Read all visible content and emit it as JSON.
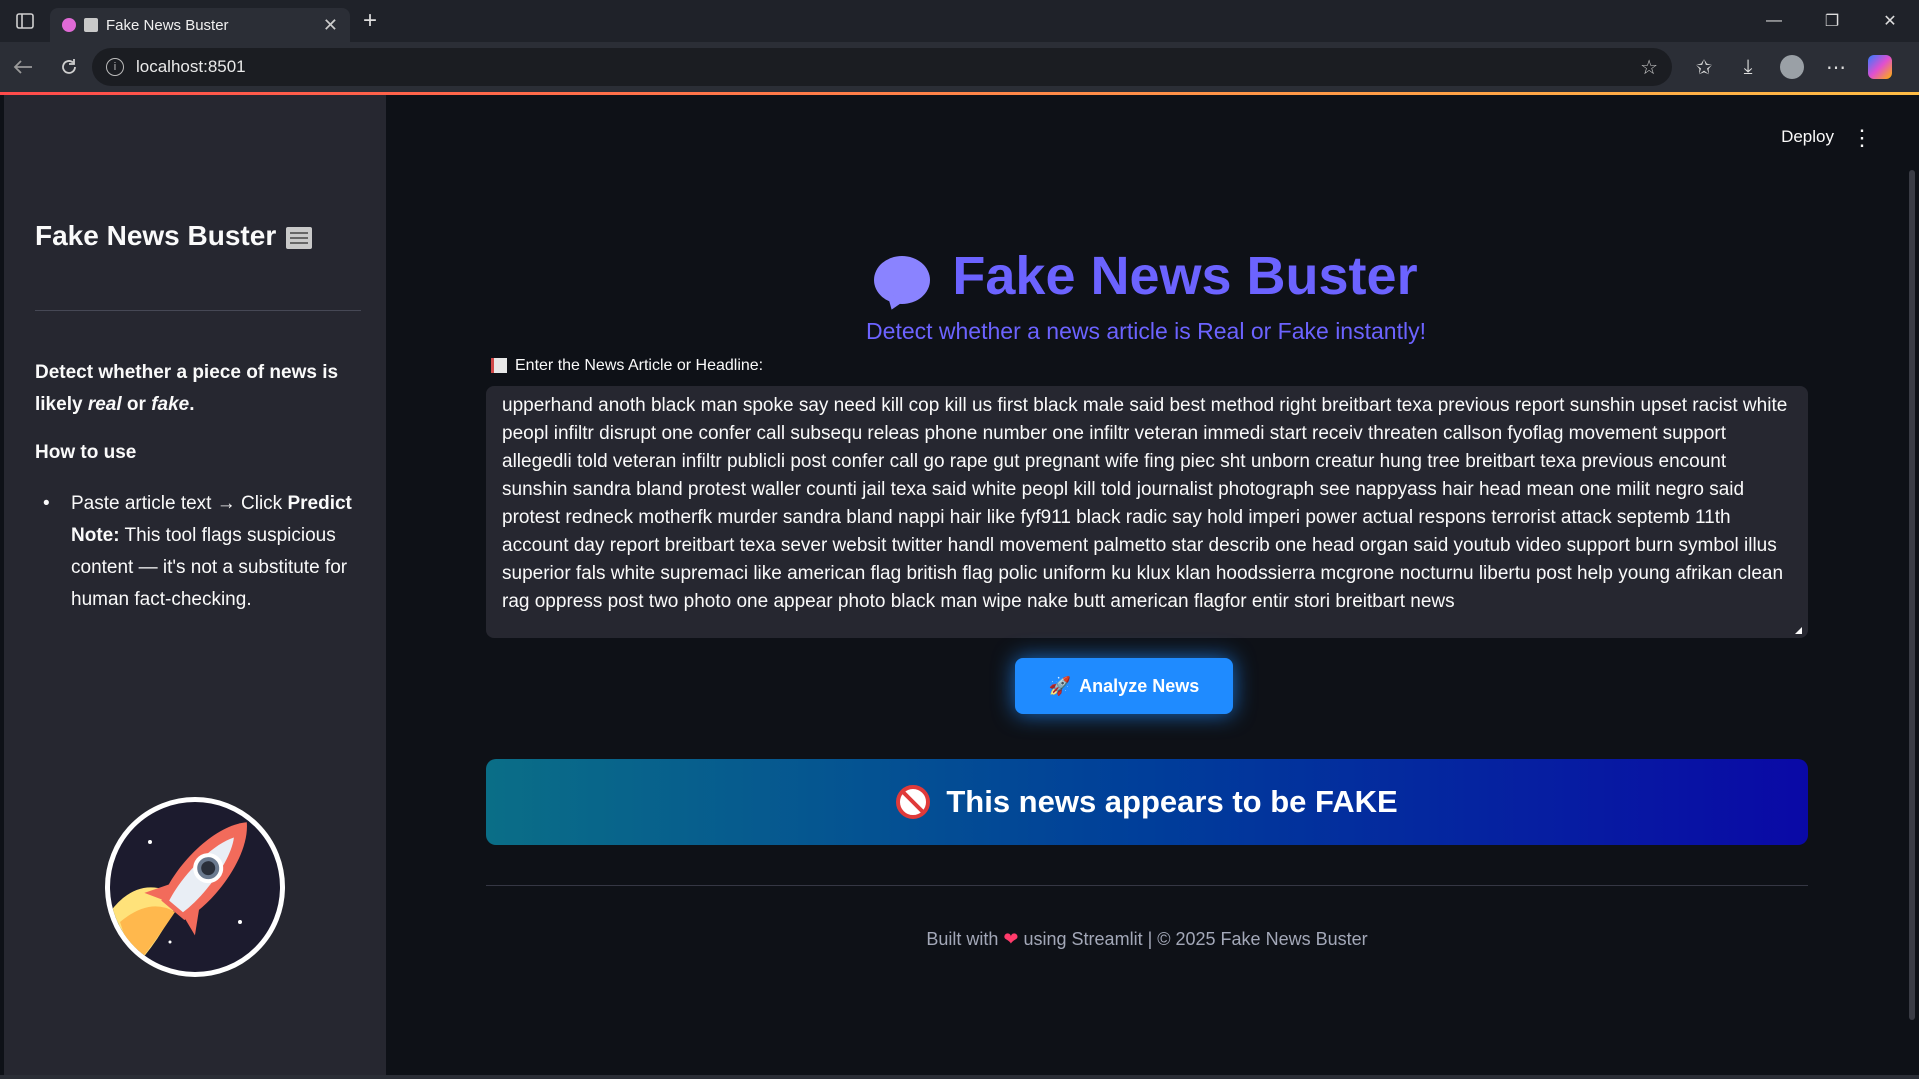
{
  "browser": {
    "tab_title": "Fake News Buster",
    "url": "localhost:8501",
    "new_tab": "+",
    "win_minimize": "—",
    "win_restore": "❐",
    "win_close": "✕",
    "tab_close": "✕"
  },
  "sidebar": {
    "title": "Fake News Buster",
    "desc_prefix": "Detect whether a piece of news is likely ",
    "desc_real": "real",
    "desc_or": " or ",
    "desc_fake": "fake",
    "desc_suffix": ".",
    "howto": "How to use",
    "bullet": "•",
    "item_paste": "Paste article text → Click ",
    "item_predict": "Predict",
    "note_label": "Note:",
    "note_text": " This tool flags suspicious content — it's not a substitute for human fact-checking."
  },
  "header": {
    "deploy": "Deploy",
    "menu": "⋮"
  },
  "main": {
    "title": "Fake News Buster",
    "subtitle": "Detect whether a news article is Real or Fake instantly!",
    "input_label": "Enter the News Article or Headline:",
    "input_value": "upperhand anoth black man spoke say need kill cop kill us first black male said best method right breitbart texa previous report sunshin upset racist white peopl infiltr disrupt one confer call subsequ releas phone number one infiltr veteran immedi start receiv threaten callson fyoflag movement support allegedli told veteran infiltr publicli post confer call go rape gut pregnant wife fing piec sht unborn creatur hung tree breitbart texa previous encount sunshin sandra bland protest waller counti jail texa said white peopl kill told journalist photograph see nappyass hair head mean one milit negro said protest redneck motherfk murder sandra bland nappi hair like fyf911 black radic say hold imperi power actual respons terrorist attack septemb 11th account day report breitbart texa sever websit twitter handl movement palmetto star describ one head organ said youtub video support burn symbol illus superior fals white supremaci like american flag british flag polic uniform ku klux klan hoodssierra mcgrone nocturnu libertu post help young afrikan clean rag oppress post two photo one appear photo black man wipe nake butt american flagfor entir stori breitbart news",
    "analyze_button": "Analyze News",
    "rocket_glyph": "🚀",
    "result": "This news appears to be FAKE",
    "footer_prefix": "Built with ",
    "footer_heart": "❤",
    "footer_suffix": " using Streamlit | © 2025 Fake News Buster"
  },
  "colors": {
    "accent_purple": "#6c63ff",
    "button_blue": "#1f8bff",
    "sidebar_bg": "#262730",
    "main_bg": "#0e1117"
  },
  "icons": [
    "sidebar-toggle-icon",
    "tab-favicon-icon",
    "back-icon",
    "reload-icon",
    "info-icon",
    "star-icon",
    "favorites-icon",
    "download-icon",
    "profile-icon",
    "more-icon",
    "copilot-icon",
    "newspaper-icon",
    "kebab-menu-icon",
    "speech-bubble-icon",
    "memo-icon",
    "rocket-icon",
    "no-entry-icon",
    "heart-icon",
    "rocket-logo"
  ]
}
